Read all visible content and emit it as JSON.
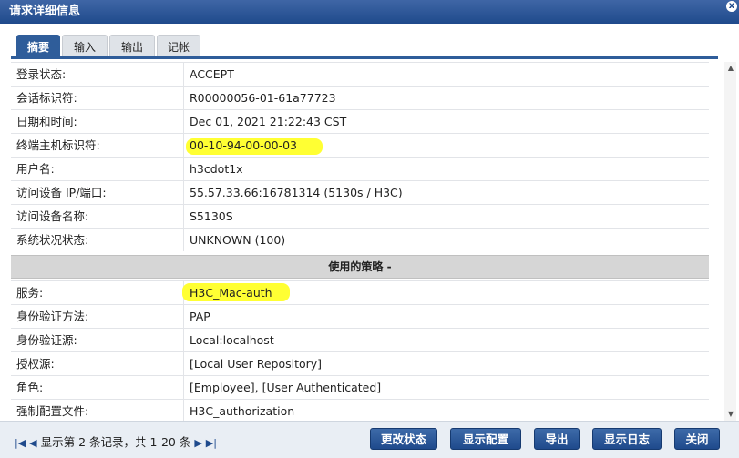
{
  "window": {
    "title": "请求详细信息",
    "close_glyph": "x"
  },
  "tabs": [
    {
      "label": "摘要",
      "active": true
    },
    {
      "label": "输入",
      "active": false
    },
    {
      "label": "输出",
      "active": false
    },
    {
      "label": "记帐",
      "active": false
    }
  ],
  "summary_rows": [
    {
      "label": "登录状态:",
      "value": "ACCEPT"
    },
    {
      "label": "会话标识符:",
      "value": "R00000056-01-61a77723"
    },
    {
      "label": "日期和时间:",
      "value": "Dec 01, 2021 21:22:43 CST"
    },
    {
      "label": "终端主机标识符:",
      "value": "00-10-94-00-00-03",
      "highlight": true
    },
    {
      "label": "用户名:",
      "value": "h3cdot1x"
    },
    {
      "label": "访问设备 IP/端口:",
      "value": "55.57.33.66:16781314 (5130s / H3C)"
    },
    {
      "label": "访问设备名称:",
      "value": "S5130S"
    },
    {
      "label": "系统状况状态:",
      "value": "UNKNOWN (100)"
    }
  ],
  "policy_section": {
    "title": "使用的策略 -"
  },
  "policy_rows": [
    {
      "label": "服务:",
      "value": "H3C_Mac-auth",
      "highlight": true
    },
    {
      "label": "身份验证方法:",
      "value": "PAP"
    },
    {
      "label": "身份验证源:",
      "value": "Local:localhost"
    },
    {
      "label": "授权源:",
      "value": "[Local User Repository]"
    },
    {
      "label": "角色:",
      "value": "[Employee], [User Authenticated]"
    },
    {
      "label": "强制配置文件:",
      "value": "H3C_authorization"
    }
  ],
  "pager": {
    "first_icon": "first-page-icon",
    "prev_icon": "prev-page-icon",
    "text": "显示第 2 条记录，共 1-20 条",
    "next_icon": "next-page-icon",
    "last_icon": "last-page-icon"
  },
  "buttons": {
    "change_status": "更改状态",
    "show_config": "显示配置",
    "export": "导出",
    "show_logs": "显示日志",
    "close": "关闭"
  },
  "colors": {
    "accent": "#1f4a8c",
    "highlight": "#ffff33"
  }
}
